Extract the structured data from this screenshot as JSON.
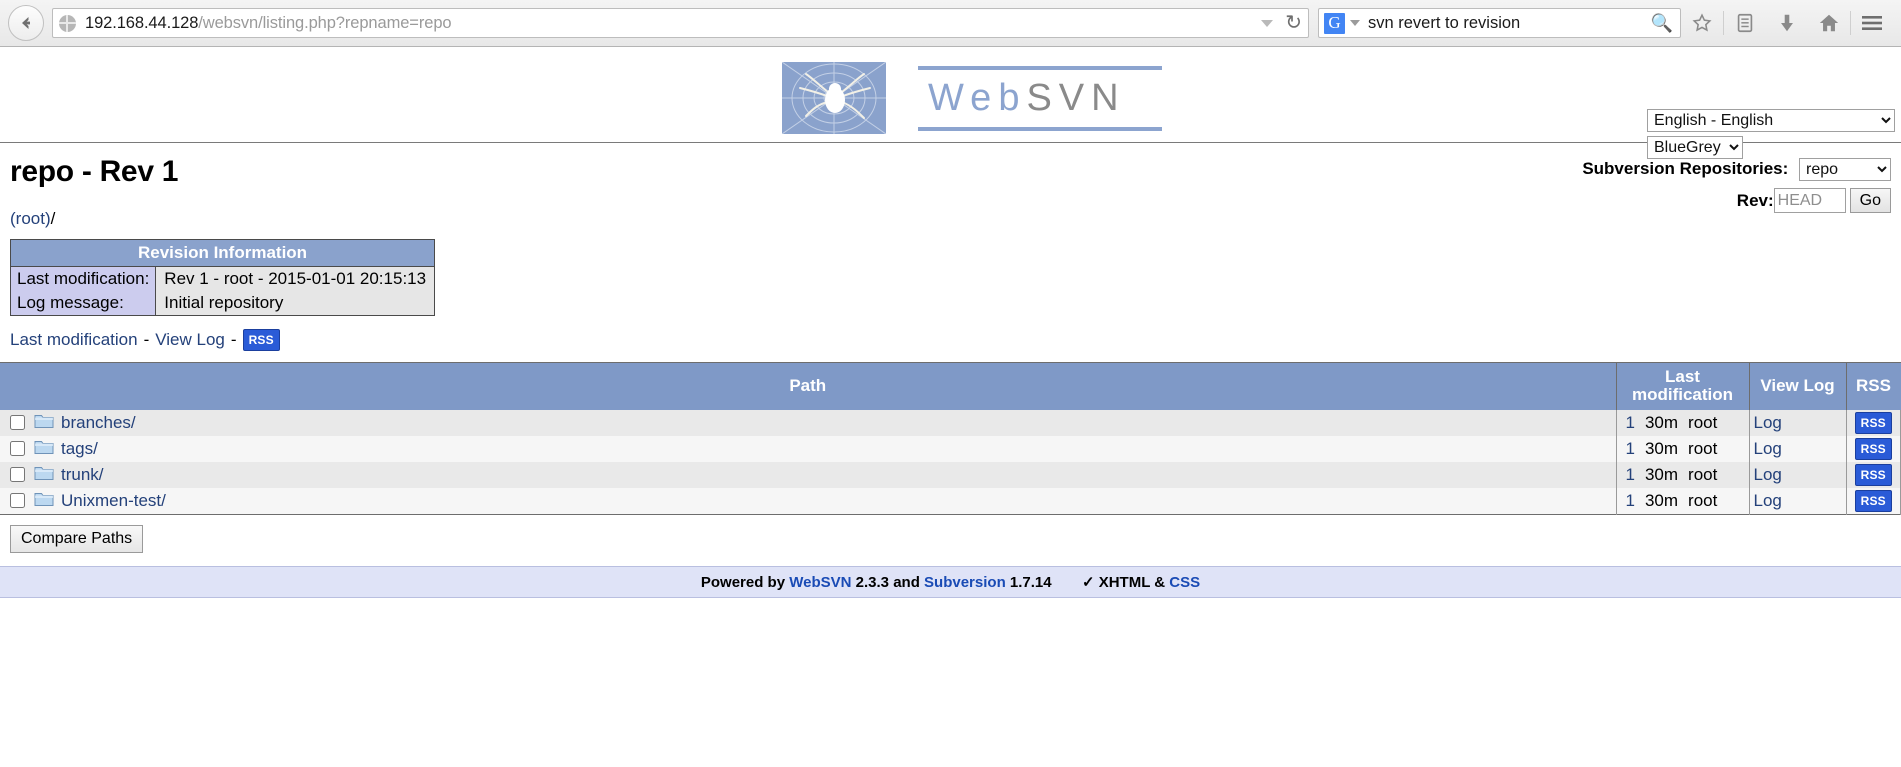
{
  "browser": {
    "back_icon": "back-arrow-icon",
    "url_host": "192.168.44.128",
    "url_path": "/websvn/listing.php?repname=repo",
    "url_full": "192.168.44.128/websvn/listing.php?repname=repo",
    "dropdown_icon": "chevron-down-icon",
    "reload_icon": "reload-icon",
    "search_engine": "G",
    "search_value": "svn revert to revision",
    "search_icon": "magnifier-icon",
    "toolbar_icons": [
      "bookmark-star-icon",
      "reading-list-icon",
      "downloads-icon",
      "home-icon",
      "menu-hamburger-icon"
    ]
  },
  "branding": {
    "logo_alt": "websvn-spider-logo",
    "word_1": "Web",
    "word_2": "SVN"
  },
  "selectors": {
    "language_value": "English - English",
    "language_options": [
      "English - English"
    ],
    "theme_value": "BlueGrey",
    "theme_options": [
      "BlueGrey"
    ]
  },
  "header": {
    "title": "repo - Rev 1",
    "repositories_label": "Subversion Repositories:",
    "repository_value": "repo",
    "repository_options": [
      "repo"
    ],
    "rev_label": "Rev:",
    "rev_placeholder": "HEAD",
    "rev_value": "",
    "go_label": "Go"
  },
  "breadcrumb": {
    "root": "(root)",
    "sep": "/"
  },
  "revision_info": {
    "caption": "Revision Information",
    "rows": [
      {
        "label": "Last modification:",
        "value": "Rev 1 - root - 2015-01-01 20:15:13"
      },
      {
        "label": "Log message:",
        "value": "Initial repository"
      }
    ]
  },
  "quick_links": {
    "last_modification": "Last modification",
    "dash_1": "-",
    "view_log": "View Log",
    "dash_2": "-",
    "rss": "RSS"
  },
  "listing": {
    "columns": {
      "path": "Path",
      "last_modification": "Last modification",
      "view_log": "View Log",
      "rss": "RSS"
    },
    "rows": [
      {
        "name": "branches/",
        "icon": "folder-icon",
        "rev": "1",
        "age": "30m",
        "author": "root",
        "log": "Log",
        "rss": "RSS"
      },
      {
        "name": "tags/",
        "icon": "folder-icon",
        "rev": "1",
        "age": "30m",
        "author": "root",
        "log": "Log",
        "rss": "RSS"
      },
      {
        "name": "trunk/",
        "icon": "folder-icon",
        "rev": "1",
        "age": "30m",
        "author": "root",
        "log": "Log",
        "rss": "RSS"
      },
      {
        "name": "Unixmen-test/",
        "icon": "folder-icon",
        "rev": "1",
        "age": "30m",
        "author": "root",
        "log": "Log",
        "rss": "RSS"
      }
    ],
    "compare_button": "Compare Paths"
  },
  "footer": {
    "powered_by": "Powered by",
    "websvn": "WebSVN",
    "websvn_version": "2.3.3",
    "and": "and",
    "subversion": "Subversion",
    "subversion_version": "1.7.14",
    "xhtml_check": "✓ XHTML",
    "amp": "&",
    "css": "CSS"
  },
  "colors": {
    "header_blue": "#7f99c7",
    "logo_blue": "#8aa2cc",
    "label_lavender": "#ccccee",
    "link_blue": "#24417a",
    "rss_blue": "#2a5bd7",
    "footer_band": "#dfe3f7"
  }
}
